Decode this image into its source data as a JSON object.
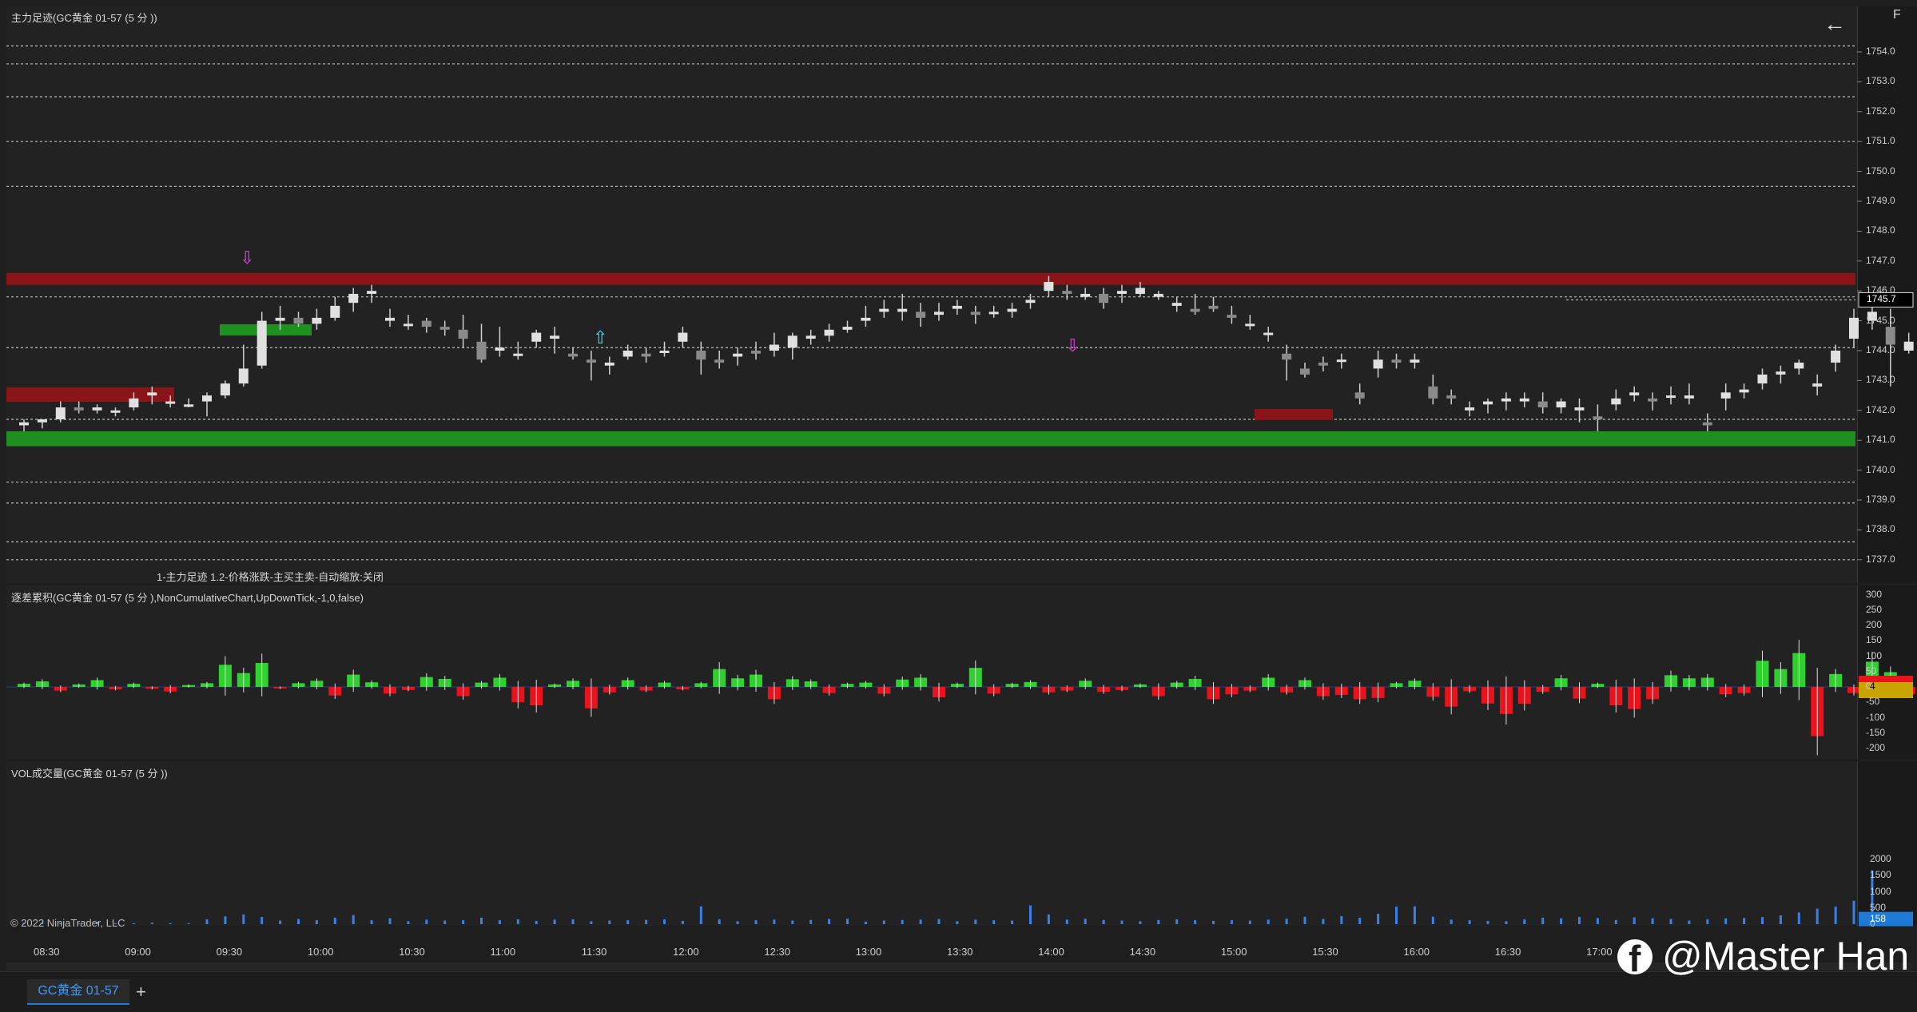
{
  "panels": {
    "price_title": "主力足迹(GC黄金 01-57 (5 分 ))",
    "indicator_label": "1-主力足迹 1.2-价格涨跌-主买主卖-自动缩放:关闭",
    "delta_title": "逐差累积(GC黄金 01-57 (5 分 ),NonCumulativeChart,UpDownTick,-1,0,false)",
    "volume_title": "VOL成交量(GC黄金 01-57 (5 分 ))",
    "credit": "© 2022 NinjaTrader, LLC"
  },
  "controls": {
    "back_glyph": "←",
    "f_label": "F"
  },
  "tabs": [
    {
      "label": "GC黄金 01-57"
    }
  ],
  "add_tab": "+",
  "watermark": "@Master Han",
  "colors": {
    "up": "#2fd12f",
    "down": "#e8131c",
    "wick": "#d0d0d0",
    "volume": "#3a80e8",
    "resistance": "#8a1518",
    "support": "#1f8f1f",
    "dotted": "#bfbfbf"
  },
  "price_axis": {
    "ticks": [
      "1754.0",
      "1753.0",
      "1752.0",
      "1751.0",
      "1750.0",
      "1749.0",
      "1748.0",
      "1747.0",
      "1746.0",
      "1745.0",
      "1744.0",
      "1743.0",
      "1742.0",
      "1741.0",
      "1740.0",
      "1739.0",
      "1738.0",
      "1737.0"
    ],
    "last_price": "1745.7"
  },
  "delta_axis": {
    "ticks": [
      "300",
      "250",
      "200",
      "150",
      "100",
      "50",
      "0",
      "-50",
      "-100",
      "-150",
      "-200"
    ],
    "last_value": "4"
  },
  "volume_axis": {
    "ticks": [
      "2000",
      "1500",
      "1000",
      "500",
      "0"
    ],
    "last_value": "158"
  },
  "time_axis": [
    "08:30",
    "09:00",
    "09:30",
    "10:00",
    "10:30",
    "11:00",
    "11:30",
    "12:00",
    "12:30",
    "13:00",
    "13:30",
    "14:00",
    "14:30",
    "15:00",
    "15:30",
    "16:00",
    "16:30",
    "17:00"
  ],
  "chart_data": {
    "type": "candlestick",
    "title": "主力足迹(GC黄金 01-57 (5 分 ))",
    "x_unit": "5-minute bars",
    "ylim": [
      1736.5,
      1754.5
    ],
    "zones": [
      {
        "kind": "resistance",
        "low": 1746.2,
        "high": 1746.6,
        "from": "08:05",
        "to": "end"
      },
      {
        "kind": "support",
        "low": 1740.8,
        "high": 1741.3,
        "from": "08:05",
        "to": "end"
      }
    ],
    "levels": [
      1754.2,
      1753.6,
      1752.5,
      1751.0,
      1749.5,
      1745.8,
      1744.1,
      1741.7,
      1739.6,
      1738.9,
      1737.6,
      1737.0
    ],
    "bars": [
      [
        "08:05",
        1741.5,
        1741.7,
        1741.3,
        1741.6
      ],
      [
        "08:10",
        1741.6,
        1741.7,
        1741.4,
        1741.7
      ],
      [
        "08:15",
        1741.7,
        1742.3,
        1741.6,
        1742.1
      ],
      [
        "08:20",
        1742.1,
        1742.3,
        1741.9,
        1742.0
      ],
      [
        "08:25",
        1742.0,
        1742.2,
        1741.9,
        1742.1
      ],
      [
        "08:30",
        1742.0,
        1742.1,
        1741.8,
        1742.0
      ],
      [
        "08:35",
        1742.1,
        1742.6,
        1742.0,
        1742.4
      ],
      [
        "08:40",
        1742.5,
        1742.8,
        1742.2,
        1742.6
      ],
      [
        "08:45",
        1742.3,
        1742.5,
        1742.1,
        1742.3
      ],
      [
        "08:50",
        1742.2,
        1742.4,
        1742.1,
        1742.2
      ],
      [
        "08:55",
        1742.3,
        1742.6,
        1741.8,
        1742.5
      ],
      [
        "09:00",
        1742.5,
        1743.0,
        1742.4,
        1742.9
      ],
      [
        "09:05",
        1742.9,
        1744.2,
        1742.8,
        1743.4
      ],
      [
        "09:10",
        1743.5,
        1745.3,
        1743.4,
        1745.0
      ],
      [
        "09:15",
        1745.0,
        1745.5,
        1744.7,
        1745.1
      ],
      [
        "09:20",
        1745.1,
        1745.3,
        1744.8,
        1744.9
      ],
      [
        "09:25",
        1744.9,
        1745.4,
        1744.7,
        1745.1
      ],
      [
        "09:30",
        1745.1,
        1745.8,
        1745.0,
        1745.5
      ],
      [
        "09:35",
        1745.6,
        1746.1,
        1745.3,
        1745.9
      ],
      [
        "09:40",
        1745.9,
        1746.2,
        1745.6,
        1746.0
      ],
      [
        "09:45",
        1745.0,
        1745.4,
        1744.8,
        1745.1
      ],
      [
        "09:50",
        1744.9,
        1745.2,
        1744.7,
        1744.9
      ],
      [
        "09:55",
        1745.0,
        1745.1,
        1744.6,
        1744.8
      ],
      [
        "10:00",
        1744.8,
        1745.0,
        1744.5,
        1744.7
      ],
      [
        "10:05",
        1744.7,
        1745.2,
        1744.1,
        1744.4
      ],
      [
        "10:10",
        1744.3,
        1744.9,
        1743.6,
        1743.7
      ],
      [
        "10:15",
        1744.0,
        1744.8,
        1743.8,
        1744.1
      ],
      [
        "10:20",
        1743.9,
        1744.3,
        1743.7,
        1743.9
      ],
      [
        "10:25",
        1744.3,
        1744.7,
        1744.1,
        1744.6
      ],
      [
        "10:30",
        1744.4,
        1744.8,
        1743.9,
        1744.5
      ],
      [
        "10:35",
        1743.9,
        1744.1,
        1743.7,
        1743.8
      ],
      [
        "10:40",
        1743.7,
        1744.0,
        1743.0,
        1743.6
      ],
      [
        "10:45",
        1743.5,
        1743.8,
        1743.2,
        1743.6
      ],
      [
        "10:50",
        1743.8,
        1744.2,
        1743.7,
        1744.0
      ],
      [
        "10:55",
        1743.9,
        1744.1,
        1743.6,
        1743.8
      ],
      [
        "11:00",
        1744.0,
        1744.3,
        1743.8,
        1744.0
      ],
      [
        "11:05",
        1744.3,
        1744.8,
        1744.1,
        1744.6
      ],
      [
        "11:10",
        1744.0,
        1744.3,
        1743.2,
        1743.7
      ],
      [
        "11:15",
        1743.7,
        1744.0,
        1743.4,
        1743.6
      ],
      [
        "11:20",
        1743.8,
        1744.1,
        1743.5,
        1743.9
      ],
      [
        "11:25",
        1744.0,
        1744.3,
        1743.7,
        1743.9
      ],
      [
        "11:30",
        1744.0,
        1744.6,
        1743.8,
        1744.2
      ],
      [
        "11:35",
        1744.1,
        1744.6,
        1743.7,
        1744.5
      ],
      [
        "11:40",
        1744.4,
        1744.7,
        1744.2,
        1744.5
      ],
      [
        "11:45",
        1744.5,
        1744.9,
        1744.3,
        1744.7
      ],
      [
        "11:50",
        1744.7,
        1745.0,
        1744.6,
        1744.8
      ],
      [
        "11:55",
        1745.0,
        1745.5,
        1744.8,
        1745.1
      ],
      [
        "12:00",
        1745.3,
        1745.7,
        1745.1,
        1745.4
      ],
      [
        "12:05",
        1745.3,
        1745.9,
        1745.0,
        1745.4
      ],
      [
        "12:10",
        1745.3,
        1745.6,
        1744.8,
        1745.1
      ],
      [
        "12:15",
        1745.2,
        1745.6,
        1745.0,
        1745.3
      ],
      [
        "12:20",
        1745.4,
        1745.7,
        1745.2,
        1745.5
      ],
      [
        "12:25",
        1745.3,
        1745.5,
        1744.9,
        1745.2
      ],
      [
        "12:30",
        1745.3,
        1745.5,
        1745.1,
        1745.3
      ],
      [
        "12:35",
        1745.3,
        1745.6,
        1745.1,
        1745.4
      ],
      [
        "12:40",
        1745.6,
        1745.9,
        1745.4,
        1745.7
      ],
      [
        "12:45",
        1746.0,
        1746.5,
        1745.8,
        1746.3
      ],
      [
        "12:50",
        1746.0,
        1746.2,
        1745.7,
        1745.9
      ],
      [
        "12:55",
        1745.8,
        1746.1,
        1745.7,
        1745.9
      ],
      [
        "13:00",
        1745.9,
        1746.1,
        1745.4,
        1745.6
      ],
      [
        "13:05",
        1745.9,
        1746.2,
        1745.6,
        1746.0
      ],
      [
        "13:10",
        1745.9,
        1746.3,
        1745.8,
        1746.1
      ],
      [
        "13:15",
        1745.8,
        1746.0,
        1745.7,
        1745.9
      ],
      [
        "13:20",
        1745.5,
        1745.8,
        1745.3,
        1745.6
      ],
      [
        "13:25",
        1745.4,
        1745.9,
        1745.2,
        1745.3
      ],
      [
        "13:30",
        1745.5,
        1745.8,
        1745.3,
        1745.4
      ],
      [
        "13:35",
        1745.2,
        1745.5,
        1744.9,
        1745.1
      ],
      [
        "13:40",
        1744.9,
        1745.2,
        1744.7,
        1744.9
      ],
      [
        "13:45",
        1744.6,
        1744.8,
        1744.3,
        1744.6
      ],
      [
        "13:50",
        1743.9,
        1744.2,
        1743.0,
        1743.7
      ],
      [
        "13:55",
        1743.4,
        1743.6,
        1743.1,
        1743.2
      ],
      [
        "14:00",
        1743.6,
        1743.8,
        1743.3,
        1743.5
      ],
      [
        "14:05",
        1743.7,
        1743.9,
        1743.4,
        1743.7
      ],
      [
        "14:10",
        1742.6,
        1742.9,
        1742.2,
        1742.4
      ],
      [
        "14:15",
        1743.4,
        1744.0,
        1743.1,
        1743.7
      ],
      [
        "14:20",
        1743.7,
        1743.9,
        1743.4,
        1743.6
      ],
      [
        "14:25",
        1743.6,
        1743.9,
        1743.4,
        1743.7
      ],
      [
        "14:30",
        1742.8,
        1743.2,
        1742.2,
        1742.4
      ],
      [
        "14:35",
        1742.5,
        1742.7,
        1742.2,
        1742.4
      ],
      [
        "14:40",
        1742.0,
        1742.3,
        1741.8,
        1742.1
      ],
      [
        "14:45",
        1742.2,
        1742.4,
        1741.9,
        1742.3
      ],
      [
        "14:50",
        1742.3,
        1742.6,
        1742.0,
        1742.4
      ],
      [
        "14:55",
        1742.3,
        1742.6,
        1742.1,
        1742.4
      ],
      [
        "15:00",
        1742.3,
        1742.6,
        1741.9,
        1742.1
      ],
      [
        "15:05",
        1742.1,
        1742.4,
        1741.9,
        1742.3
      ],
      [
        "15:10",
        1742.0,
        1742.4,
        1741.6,
        1742.1
      ],
      [
        "15:15",
        1741.8,
        1742.2,
        1741.3,
        1741.7
      ],
      [
        "15:20",
        1742.2,
        1742.7,
        1742.0,
        1742.4
      ],
      [
        "15:25",
        1742.5,
        1742.8,
        1742.3,
        1742.6
      ],
      [
        "15:30",
        1742.4,
        1742.6,
        1742.0,
        1742.3
      ],
      [
        "15:35",
        1742.5,
        1742.8,
        1742.2,
        1742.5
      ],
      [
        "15:40",
        1742.4,
        1742.9,
        1742.2,
        1742.5
      ],
      [
        "15:45",
        1741.6,
        1741.9,
        1741.3,
        1741.5
      ],
      [
        "15:50",
        1742.4,
        1742.9,
        1742.0,
        1742.6
      ],
      [
        "15:55",
        1742.6,
        1742.9,
        1742.4,
        1742.7
      ],
      [
        "16:00",
        1742.9,
        1743.4,
        1742.7,
        1743.2
      ],
      [
        "16:05",
        1743.2,
        1743.5,
        1742.9,
        1743.3
      ],
      [
        "16:10",
        1743.4,
        1743.7,
        1743.2,
        1743.6
      ],
      [
        "16:15",
        1742.8,
        1743.2,
        1742.5,
        1742.9
      ],
      [
        "16:20",
        1743.6,
        1744.2,
        1743.3,
        1744.0
      ],
      [
        "16:25",
        1744.4,
        1745.4,
        1744.1,
        1745.1
      ],
      [
        "16:30",
        1745.0,
        1745.8,
        1744.7,
        1745.3
      ],
      [
        "16:35",
        1744.8,
        1745.4,
        1742.8,
        1744.2
      ],
      [
        "16:40",
        1744.0,
        1744.6,
        1743.9,
        1744.3
      ],
      [
        "16:45",
        1744.2,
        1744.5,
        1743.6,
        1744.1
      ],
      [
        "16:50",
        1744.6,
        1745.2,
        1744.4,
        1745.0
      ],
      [
        "16:55",
        1745.2,
        1746.5,
        1744.9,
        1746.3
      ],
      [
        "17:00",
        1746.6,
        1747.6,
        1746.3,
        1747.1
      ],
      [
        "17:05",
        1746.8,
        1747.2,
        1746.6,
        1746.9
      ],
      [
        "17:10",
        1745.3,
        1745.6,
        1744.8,
        1745.2
      ],
      [
        "17:15",
        1745.5,
        1745.9,
        1745.3,
        1745.6
      ]
    ],
    "delta": [
      10,
      18,
      -12,
      8,
      22,
      -8,
      10,
      -6,
      -15,
      6,
      12,
      72,
      45,
      78,
      -5,
      12,
      20,
      -28,
      40,
      15,
      -22,
      -10,
      32,
      26,
      -30,
      14,
      30,
      -50,
      -60,
      8,
      20,
      -70,
      -18,
      22,
      -12,
      14,
      -8,
      12,
      58,
      28,
      40,
      -40,
      25,
      18,
      -20,
      10,
      14,
      -22,
      24,
      30,
      -34,
      10,
      62,
      -22,
      10,
      16,
      -18,
      -12,
      20,
      -16,
      -10,
      8,
      -30,
      14,
      26,
      -40,
      -24,
      -12,
      30,
      -18,
      22,
      -30,
      -26,
      -40,
      -36,
      12,
      20,
      -32,
      -64,
      -14,
      -54,
      -88,
      -55,
      -16,
      28,
      -38,
      10,
      -60,
      -72,
      -40,
      38,
      28,
      30,
      -24,
      -20,
      85,
      58,
      110,
      -160,
      42,
      -20,
      82,
      48,
      -24,
      122,
      42,
      50,
      -70,
      -36,
      18,
      24,
      18
    ],
    "volume": [
      40,
      55,
      35,
      25,
      70,
      30,
      28,
      45,
      30,
      28,
      150,
      240,
      300,
      220,
      110,
      160,
      120,
      200,
      280,
      120,
      180,
      90,
      140,
      110,
      120,
      200,
      120,
      150,
      100,
      140,
      150,
      90,
      110,
      120,
      130,
      150,
      100,
      550,
      150,
      90,
      120,
      140,
      110,
      130,
      160,
      170,
      80,
      110,
      130,
      140,
      160,
      90,
      140,
      120,
      110,
      580,
      300,
      140,
      170,
      130,
      110,
      90,
      130,
      150,
      120,
      100,
      120,
      110,
      140,
      170,
      230,
      160,
      250,
      200,
      320,
      540,
      550,
      230,
      140,
      120,
      100,
      90,
      150,
      200,
      180,
      220,
      190,
      130,
      210,
      180,
      160,
      110,
      150,
      180,
      190,
      220,
      270,
      360,
      480,
      540,
      720,
      1660,
      370,
      250,
      820,
      650,
      1880,
      260,
      600,
      720,
      1260,
      300,
      2350,
      270,
      170,
      200,
      160,
      150
    ]
  }
}
